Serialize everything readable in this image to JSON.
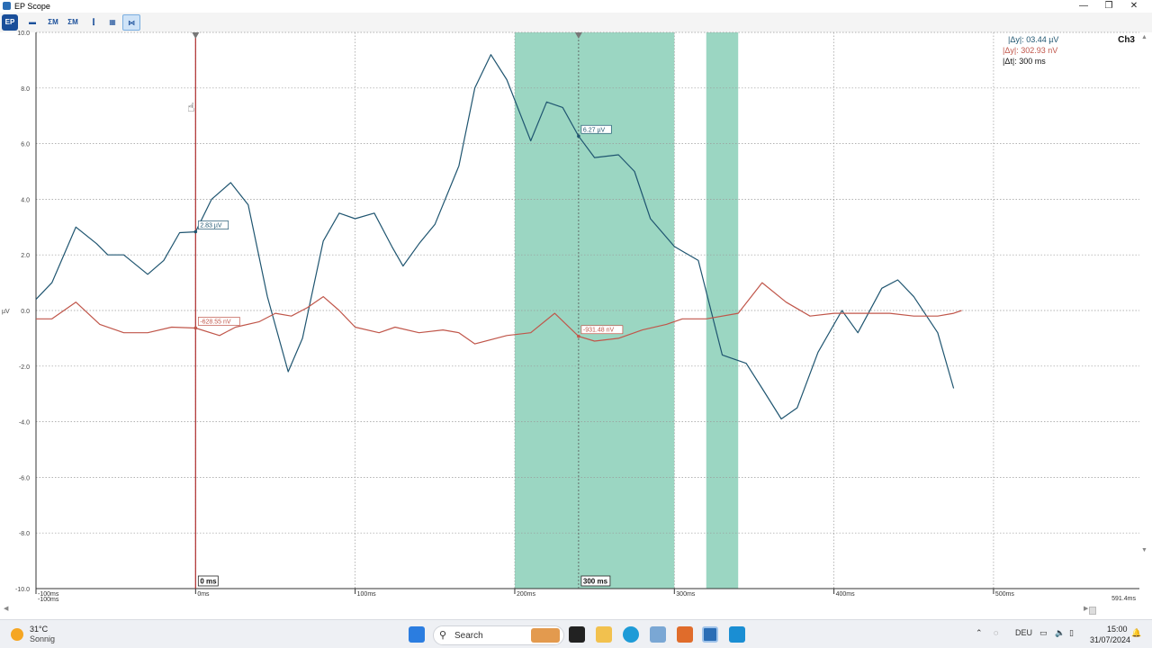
{
  "window": {
    "title": "EP Scope",
    "min_glyph": "—",
    "max_glyph": "❐",
    "close_glyph": "✕"
  },
  "toolbar": [
    {
      "icon": "logo-badge-icon",
      "glyph": "EP"
    },
    {
      "icon": "average-icon",
      "glyph": "▬"
    },
    {
      "icon": "waveform-a-icon",
      "glyph": "ΣΜ"
    },
    {
      "icon": "waveform-b-icon",
      "glyph": "ΣΜ"
    },
    {
      "icon": "split-channels-icon",
      "glyph": "⫿"
    },
    {
      "icon": "grid-layout-icon",
      "glyph": "▦"
    },
    {
      "icon": "cursor-measure-icon",
      "glyph": "⋈",
      "active": true
    }
  ],
  "chart_data": {
    "type": "line",
    "channel": "Ch3",
    "ylabel": "µV",
    "ylim": [
      -10,
      10
    ],
    "xlim": [
      -100,
      591.4
    ],
    "y_ticks": [
      "10.0",
      "8.0",
      "6.0",
      "4.0",
      "2.0",
      "0.0",
      "-2.0",
      "-4.0",
      "-6.0",
      "-8.0",
      "-10.0"
    ],
    "x_ticks": [
      {
        "v": -100,
        "label": "-100ms",
        "sub": "-100ms"
      },
      {
        "v": 0,
        "label": "0ms"
      },
      {
        "v": 100,
        "label": "100ms"
      },
      {
        "v": 200,
        "label": "200ms"
      },
      {
        "v": 300,
        "label": "300ms"
      },
      {
        "v": 400,
        "label": "400ms"
      },
      {
        "v": 500,
        "label": "500ms"
      }
    ],
    "x_end_label": "591.4ms",
    "grid": true,
    "highlight_regions": [
      [
        200,
        300
      ],
      [
        320,
        340
      ]
    ],
    "series": [
      {
        "color": "#1f5570",
        "points": [
          [
            -100,
            0.4
          ],
          [
            -90,
            1.0
          ],
          [
            -75,
            3.0
          ],
          [
            -62,
            2.4
          ],
          [
            -55,
            2.0
          ],
          [
            -45,
            2.0
          ],
          [
            -30,
            1.3
          ],
          [
            -20,
            1.8
          ],
          [
            -10,
            2.8
          ],
          [
            0,
            2.83
          ],
          [
            10,
            4.0
          ],
          [
            22,
            4.6
          ],
          [
            33,
            3.8
          ],
          [
            45,
            0.5
          ],
          [
            58,
            -2.2
          ],
          [
            67,
            -1.0
          ],
          [
            80,
            2.5
          ],
          [
            90,
            3.5
          ],
          [
            100,
            3.3
          ],
          [
            112,
            3.5
          ],
          [
            123,
            2.3
          ],
          [
            130,
            1.6
          ],
          [
            140,
            2.4
          ],
          [
            150,
            3.1
          ],
          [
            165,
            5.2
          ],
          [
            175,
            8.0
          ],
          [
            185,
            9.2
          ],
          [
            195,
            8.3
          ],
          [
            210,
            6.1
          ],
          [
            220,
            7.5
          ],
          [
            230,
            7.3
          ],
          [
            240,
            6.27
          ],
          [
            250,
            5.5
          ],
          [
            265,
            5.6
          ],
          [
            275,
            5.0
          ],
          [
            285,
            3.3
          ],
          [
            300,
            2.3
          ],
          [
            315,
            1.8
          ],
          [
            330,
            -1.6
          ],
          [
            345,
            -1.9
          ],
          [
            355,
            -2.8
          ],
          [
            367,
            -3.9
          ],
          [
            377,
            -3.5
          ],
          [
            390,
            -1.5
          ],
          [
            405,
            0.0
          ],
          [
            415,
            -0.8
          ],
          [
            430,
            0.8
          ],
          [
            440,
            1.1
          ],
          [
            450,
            0.5
          ],
          [
            465,
            -0.8
          ],
          [
            475,
            -2.8
          ]
        ]
      },
      {
        "color": "#c0564a",
        "points": [
          [
            -100,
            -0.3
          ],
          [
            -90,
            -0.3
          ],
          [
            -75,
            0.3
          ],
          [
            -60,
            -0.5
          ],
          [
            -45,
            -0.8
          ],
          [
            -30,
            -0.8
          ],
          [
            -15,
            -0.6
          ],
          [
            0,
            -0.63
          ],
          [
            15,
            -0.9
          ],
          [
            25,
            -0.6
          ],
          [
            40,
            -0.4
          ],
          [
            50,
            -0.1
          ],
          [
            60,
            -0.2
          ],
          [
            70,
            0.1
          ],
          [
            80,
            0.5
          ],
          [
            90,
            0.0
          ],
          [
            100,
            -0.6
          ],
          [
            115,
            -0.8
          ],
          [
            125,
            -0.6
          ],
          [
            140,
            -0.8
          ],
          [
            155,
            -0.7
          ],
          [
            165,
            -0.8
          ],
          [
            175,
            -1.2
          ],
          [
            195,
            -0.9
          ],
          [
            210,
            -0.8
          ],
          [
            225,
            -0.1
          ],
          [
            240,
            -0.93
          ],
          [
            250,
            -1.1
          ],
          [
            265,
            -1.0
          ],
          [
            280,
            -0.7
          ],
          [
            295,
            -0.5
          ],
          [
            305,
            -0.3
          ],
          [
            320,
            -0.3
          ],
          [
            340,
            -0.1
          ],
          [
            355,
            1.0
          ],
          [
            370,
            0.3
          ],
          [
            385,
            -0.2
          ],
          [
            400,
            -0.1
          ],
          [
            420,
            -0.1
          ],
          [
            435,
            -0.1
          ],
          [
            450,
            -0.2
          ],
          [
            465,
            -0.2
          ],
          [
            475,
            -0.1
          ],
          [
            480,
            0.0
          ]
        ]
      }
    ],
    "cursors": [
      {
        "x": 0,
        "label": "0 ms",
        "kind": "solid"
      },
      {
        "x": 240,
        "label": "300 ms",
        "kind": "dashed"
      }
    ],
    "markers": [
      {
        "x": 0,
        "y": 2.83,
        "label": "2.83 µV",
        "series": 0
      },
      {
        "x": 0,
        "y": -0.63,
        "label": "-628.55 nV",
        "series": 1
      },
      {
        "x": 240,
        "y": 6.27,
        "label": "6.27 µV",
        "series": 0
      },
      {
        "x": 240,
        "y": -0.93,
        "label": "-931.48 nV",
        "series": 1
      }
    ],
    "deltas": {
      "dy1": "|Δy|: 03.44 µV",
      "dy2": "|Δy|: 302.93 nV",
      "dt": "|Δt|: 300 ms"
    }
  },
  "taskbar": {
    "weather_temp": "31°C",
    "weather_desc": "Sonnig",
    "search_label": "Search",
    "language": "DEU",
    "time": "15:00",
    "date": "31/07/2024"
  }
}
